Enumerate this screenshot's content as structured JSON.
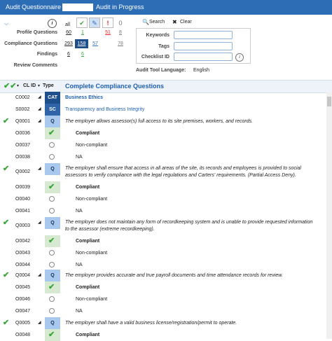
{
  "window": {
    "title_prefix": "Audit Questionnaire -",
    "title_suffix": "Audit in Progress"
  },
  "filters": {
    "profile_questions_label": "Profile Questions",
    "compliance_questions_label": "Compliance Questions",
    "findings_label": "Findings",
    "review_comments_label": "Review Comments",
    "all_label": "all",
    "profile_counts": {
      "all": "60",
      "check": "1",
      "flag": "51",
      "zero": "8"
    },
    "compliance_counts": {
      "all": "293",
      "check": "158",
      "pencil": "57",
      "zero": "78"
    },
    "findings_counts": {
      "all": "6",
      "check": "6"
    }
  },
  "search": {
    "search_label": "Search",
    "clear_label": "Clear",
    "keywords_label": "Keywords",
    "tags_label": "Tags",
    "checklist_id_label": "Checklist ID",
    "keywords_value": "",
    "tags_value": "",
    "checklist_value": "",
    "language_label": "Audit Tool Language:",
    "language_value": "English"
  },
  "grid": {
    "col_id": "CL ID",
    "col_type": "Type",
    "section_title": "Complete Compliance Questions",
    "rows": [
      {
        "id": "C0002",
        "type": "CAT",
        "text": "Business Ethics"
      },
      {
        "id": "S0002",
        "type": "SC",
        "text": "Transparency and Business Integrity"
      },
      {
        "id": "Q0001",
        "type": "Q",
        "text": "The employer allows assessor(s) full access to its site premises, workers, and records."
      },
      {
        "id": "O0036",
        "text": "Compliant"
      },
      {
        "id": "O0037",
        "text": "Non-compliant"
      },
      {
        "id": "O0038",
        "text": "NA"
      },
      {
        "id": "Q0002",
        "type": "Q",
        "text": "The employer shall ensure that access in all areas of the site, its records and employees is provided to social",
        "text2": "assessors to verify compliance with the legal regulations and Carters' requirements. (Partial Access Deny)."
      },
      {
        "id": "O0039",
        "text": "Compliant"
      },
      {
        "id": "O0040",
        "text": "Non-compliant"
      },
      {
        "id": "O0041",
        "text": "NA"
      },
      {
        "id": "Q0003",
        "type": "Q",
        "text": "The employer does not maintain any form of recordkeeping system and is unable to provide requested information",
        "text2": "to the assessor (extreme recordkeeping)."
      },
      {
        "id": "O0042",
        "text": "Compliant"
      },
      {
        "id": "O0043",
        "text": "Non-compliant"
      },
      {
        "id": "O0044",
        "text": "NA"
      },
      {
        "id": "Q0004",
        "type": "Q",
        "text": "The employer provides accurate and true payroll documents and time attendance records for review."
      },
      {
        "id": "O0045",
        "text": "Compliant"
      },
      {
        "id": "O0046",
        "text": "Non-compliant"
      },
      {
        "id": "O0047",
        "text": "NA"
      },
      {
        "id": "Q0005",
        "type": "Q",
        "text": "The employer shall have a valid business license/registration/permit to operate."
      },
      {
        "id": "O0048",
        "text": "Compliant"
      }
    ]
  },
  "colors": {
    "title_bar": "#2d6db5",
    "cat": "#1f4e8c",
    "sc": "#2f64a8",
    "q": "#a8c8ee",
    "link": "#1d5fb3",
    "check": "#3aa63a"
  }
}
